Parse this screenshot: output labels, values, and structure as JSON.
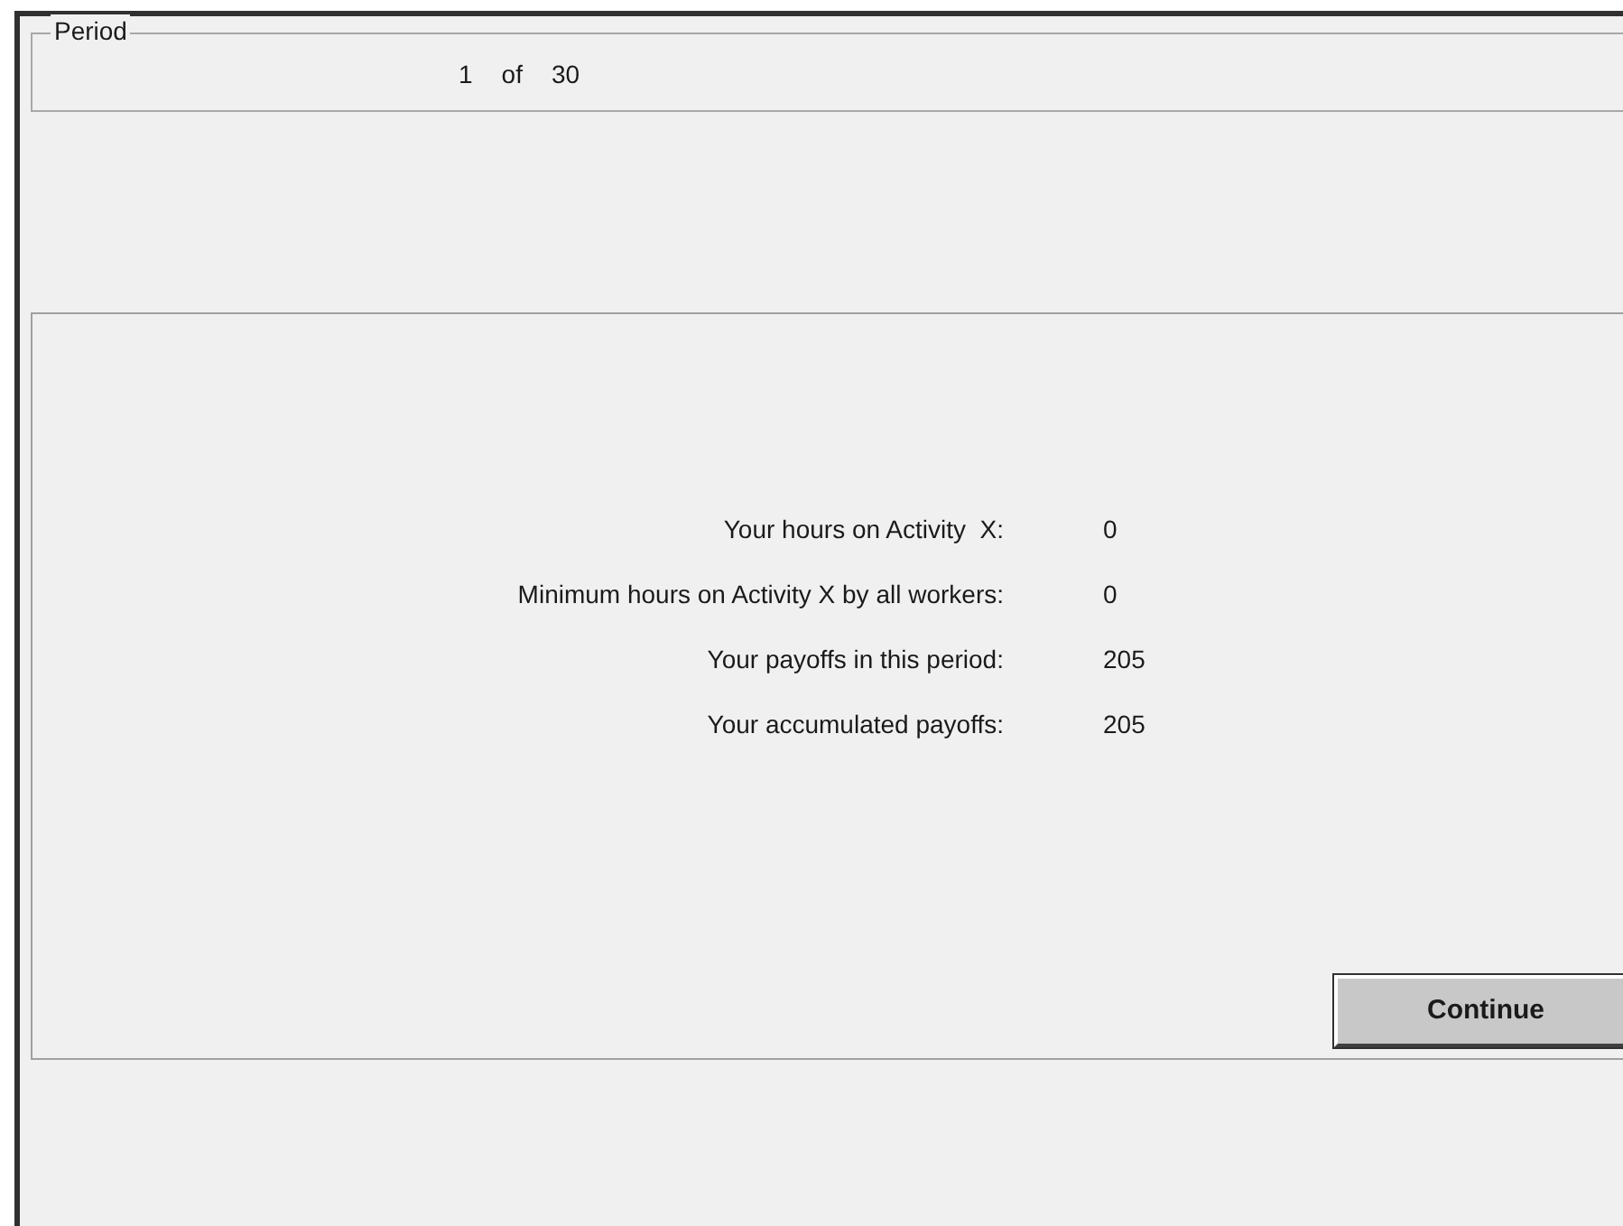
{
  "period": {
    "legend": "Period",
    "current": "1",
    "separator": "of",
    "total": "30"
  },
  "results": [
    {
      "label": "Your hours on Activity  X:",
      "value": "0"
    },
    {
      "label": "Minimum hours on Activity X by all workers:",
      "value": "0"
    },
    {
      "label": "Your payoffs in this period:",
      "value": "205"
    },
    {
      "label": "Your accumulated payoffs:",
      "value": "205"
    }
  ],
  "buttons": [
    "Continue"
  ]
}
